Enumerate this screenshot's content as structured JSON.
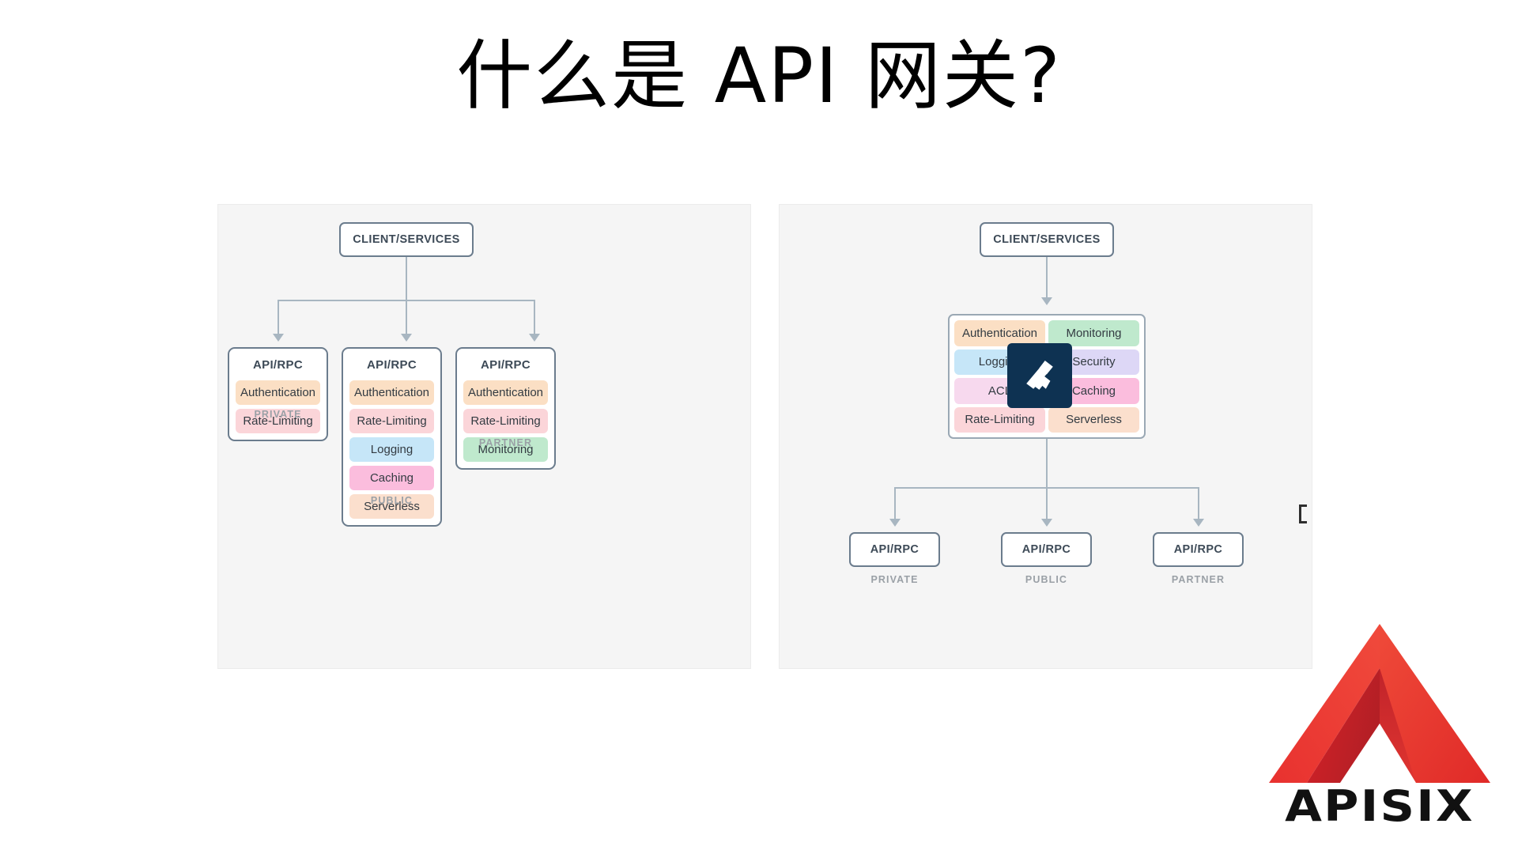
{
  "slide": {
    "title": "什么是 API 网关?",
    "background_color": "#ffffff"
  },
  "colors": {
    "panel_bg": "#f5f5f5",
    "box_border": "#6b7c8d",
    "connector": "#a8b6c1",
    "caption": "#9aa0a6",
    "authentication": "#fbdfc4",
    "rate_limiting": "#fbd5d9",
    "logging": "#c6e6f8",
    "caching": "#fbbddd",
    "serverless": "#fbdfcd",
    "monitoring": "#bfe9cd",
    "security": "#ddd7f6",
    "acl": "#f7d9ee",
    "gateway_tile": "#0e3252",
    "logo_red": "#e8262a"
  },
  "panels": [
    {
      "id": "before",
      "name": "without-api-gateway",
      "client_box": {
        "label": "CLIENT/SERVICES"
      },
      "columns": [
        {
          "title": "API/RPC",
          "caption": "PRIVATE",
          "plugins": [
            {
              "label": "Authentication",
              "color": "#fbdfc4"
            },
            {
              "label": "Rate-Limiting",
              "color": "#fbd5d9"
            }
          ]
        },
        {
          "title": "API/RPC",
          "caption": "PUBLIC",
          "plugins": [
            {
              "label": "Authentication",
              "color": "#fbdfc4"
            },
            {
              "label": "Rate-Limiting",
              "color": "#fbd5d9"
            },
            {
              "label": "Logging",
              "color": "#c6e6f8"
            },
            {
              "label": "Caching",
              "color": "#fbbddd"
            },
            {
              "label": "Serverless",
              "color": "#fbdfcd"
            }
          ]
        },
        {
          "title": "API/RPC",
          "caption": "PARTNER",
          "plugins": [
            {
              "label": "Authentication",
              "color": "#fbdfc4"
            },
            {
              "label": "Rate-Limiting",
              "color": "#fbd5d9"
            },
            {
              "label": "Monitoring",
              "color": "#bfe9cd"
            }
          ]
        }
      ]
    },
    {
      "id": "after",
      "name": "with-api-gateway",
      "client_box": {
        "label": "CLIENT/SERVICES"
      },
      "gateway": {
        "logo_tile_name": "apisix-gateway-logo",
        "tiles": [
          {
            "label": "Authentication",
            "color": "#fbdfc4"
          },
          {
            "label": "Monitoring",
            "color": "#bfe9cd"
          },
          {
            "label": "Logging",
            "color": "#c6e6f8"
          },
          {
            "label": "Security",
            "color": "#ddd7f6"
          },
          {
            "label": "ACL",
            "color": "#f7d9ee"
          },
          {
            "label": "Caching",
            "color": "#fbbddd"
          },
          {
            "label": "Rate-Limiting",
            "color": "#fbd5d9"
          },
          {
            "label": "Serverless",
            "color": "#fbdfcd"
          }
        ]
      },
      "endpoints": [
        {
          "title": "API/RPC",
          "caption": "PRIVATE"
        },
        {
          "title": "API/RPC",
          "caption": "PUBLIC"
        },
        {
          "title": "API/RPC",
          "caption": "PARTNER"
        }
      ]
    }
  ],
  "logo": {
    "wordmark": "APISIX",
    "mark_name": "apisix-chevron-mark"
  }
}
